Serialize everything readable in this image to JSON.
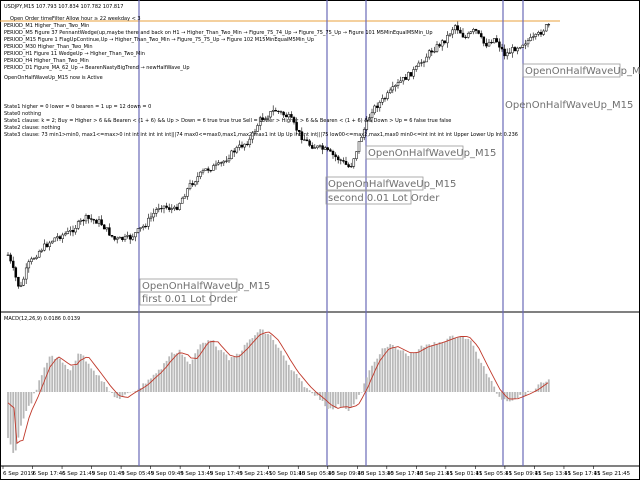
{
  "window": {
    "symbol_header": "USDJPY,M15  107.793 107.834 107.782 107.817",
    "info_lines": [
      "Open Order timeFilter Allow hour ≥ 22 weekday < 3",
      "PERIOD_M1   Higher_Than_Two_Min",
      "PERIOD_M5   Figure 37 PennantWedge(up,maybe there and back on H1 → Higher_Than_Two_Min → Figure_75_74_Up → Figure_75_75_Up → Figure 101 M5MinEqualM5Min_Up",
      "PERIOD_M15  Figure 1 FlagUpContinue,Up → Higher_Than_Two_Min → Figure_75_75_Up → Figure 102 M15MinEqualM5Min_Up",
      "PERIOD_M30  Higher_Than_Two_Min",
      "PERIOD_H1   Figure 11 WedgeUp → Higher_Than_Two_Min",
      "PERIOD_H4   Higher_Than_Two_Min",
      "PERIOD_D1   Figure_MA_62_Up  → BearenNastyBigTrend → newHalfWave_Up"
    ],
    "active_line": "OpenOnHalfWaveUp_M15 now is Active",
    "state_lines": [
      "State1      higher = 0 lower = 0 bearen = 1 up = 12 down = 0",
      "State0      nothing",
      "State1 clause: k = 2; Buy = Higher > 6 && Bearen < (1 + 6) && Up > Down = 6 true true true Sell = Lower > Higher > 6 && Bearen < (1 + 6) && Down > Up = 6 false true false",
      "State2 clause: nothing",
      "State3 clause: 73 min1>min0, max1<=max>0 int int int int int int|||74 max0<=max0,max1,max2,max1 int Up Up int int int|||75 low00<=max2,max1,max0 min0<=int int int int Upper Lower Up Int 0.236"
    ],
    "macd_label": "MACD(12,26,9) 0.0186 0.0139",
    "x_ticks": [
      "6 Sep 2019",
      "6 Sep 17:45",
      "6 Sep 21:45",
      "9 Sep 01:45",
      "9 Sep 05:45",
      "9 Sep 09:45",
      "9 Sep 13:45",
      "9 Sep 17:45",
      "9 Sep 21:45",
      "10 Sep 01:45",
      "10 Sep 05:45",
      "10 Sep 09:45",
      "10 Sep 13:45",
      "10 Sep 17:45",
      "10 Sep 21:45",
      "11 Sep 01:45",
      "11 Sep 05:45",
      "11 Sep 09:45",
      "11 Sep 13:45",
      "11 Sep 17:45",
      "11 Sep 21:45"
    ],
    "annotations": [
      {
        "name": "annotation-open-1",
        "text": "OpenOnHalfWaveUp_M15",
        "boxed": true
      },
      {
        "name": "annotation-first-lot",
        "text": "first 0.01 Lot Order",
        "boxed": true
      },
      {
        "name": "annotation-open-2",
        "text": "OpenOnHalfWaveUp_M15",
        "boxed": true
      },
      {
        "name": "annotation-second-lot",
        "text": "second 0.01 Lot Order",
        "boxed": true
      },
      {
        "name": "annotation-open-3",
        "text": "OpenOnHalfWaveUp_M15",
        "boxed": true
      },
      {
        "name": "annotation-open-4",
        "text": "OpenOnHalfWaveUp_M15",
        "boxed": false
      },
      {
        "name": "annotation-open-5",
        "text": "OpenOnHalfWaveUp_M15",
        "boxed": true
      }
    ],
    "colors": {
      "background": "#ffffff",
      "candle": "#000000",
      "vline": "#6a6ab8",
      "hline": "#e8a23c",
      "signal": "#c0392b",
      "histogram": "#b8b8b8",
      "annotation": "#707070"
    }
  }
}
